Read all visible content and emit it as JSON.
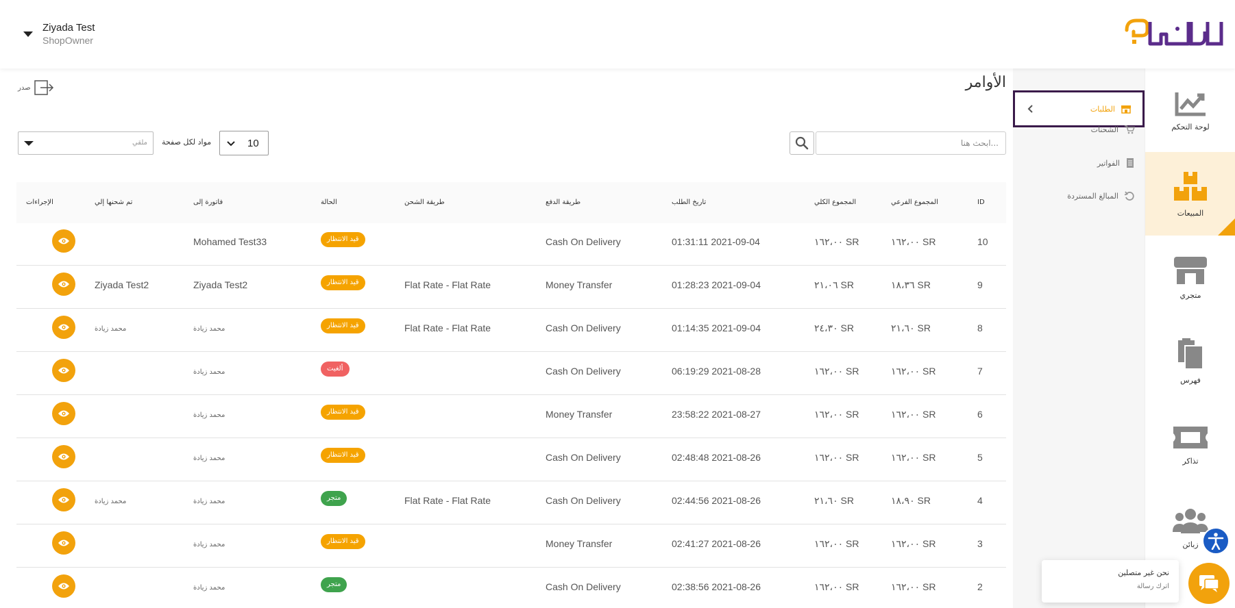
{
  "colors": {
    "accent": "#f2a20c",
    "accent_light": "#fdf0d8",
    "active_border": "#3a1a4a",
    "pending": "#f5a300",
    "canceled": "#f06262",
    "shipped": "#3fa34d",
    "purple": "#5b2c8b"
  },
  "user": {
    "name": "Ziyada Test",
    "role": "ShopOwner"
  },
  "logo": {
    "alt": "كليفا"
  },
  "rail": [
    {
      "label": "لوحة التحكم",
      "icon": "chart-icon",
      "active": false
    },
    {
      "label": "المبيعات",
      "icon": "boxes-icon",
      "active": true
    },
    {
      "label": "متجري",
      "icon": "store-icon",
      "active": false
    },
    {
      "label": "فهرس",
      "icon": "catalog-icon",
      "active": false
    },
    {
      "label": "تذاكر",
      "icon": "ticket-icon",
      "active": false
    },
    {
      "label": "زبائن",
      "icon": "customers-icon",
      "active": false
    }
  ],
  "submenu": [
    {
      "label": "الطلبات",
      "icon": "orders-icon",
      "active": true
    },
    {
      "label": "الشحنات",
      "icon": "cart-icon",
      "active": false
    },
    {
      "label": "الفواتير",
      "icon": "invoice-icon",
      "active": false
    },
    {
      "label": "المبالغ المستردة",
      "icon": "refund-icon",
      "active": false
    }
  ],
  "page": {
    "title": "الأوامر",
    "export_label": "صدر",
    "search_placeholder": "...ابحث هنا",
    "per_page_label": "مواد لكل صفحة",
    "per_page_value": "10",
    "filter_placeholder": "ملقي"
  },
  "columns": {
    "id": "ID",
    "subtotal": "المجموع الفرعي",
    "grand_total": "المجموع الكلي",
    "order_date": "تاريخ الطلب",
    "payment": "طريقة الدفع",
    "shipping": "طريقة الشحن",
    "status": "الحالة",
    "billed_to": "فاتورة إلى",
    "shipped_to": "تم شحنها إلي",
    "actions": "الإجراءات"
  },
  "orders": [
    {
      "id": "10",
      "subtotal": "١٦٢،٠٠ SR",
      "grand_total": "١٦٢،٠٠ SR",
      "date": "01:31:11 2021-09-04",
      "payment": "Cash On Delivery",
      "shipping": "",
      "status": "قيد الانتظار",
      "status_type": "pending",
      "billed_to": "Mohamed Test33",
      "billed_small": false,
      "shipped_to": "",
      "shipped_small": false
    },
    {
      "id": "9",
      "subtotal": "١٨،٣٦ SR",
      "grand_total": "٢١،٠٦ SR",
      "date": "01:28:23 2021-09-04",
      "payment": "Money Transfer",
      "shipping": "Flat Rate - Flat Rate",
      "status": "قيد الانتظار",
      "status_type": "pending",
      "billed_to": "Ziyada Test2",
      "billed_small": false,
      "shipped_to": "Ziyada Test2",
      "shipped_small": false
    },
    {
      "id": "8",
      "subtotal": "٢١،٦٠ SR",
      "grand_total": "٢٤،٣٠ SR",
      "date": "01:14:35 2021-09-04",
      "payment": "Cash On Delivery",
      "shipping": "Flat Rate - Flat Rate",
      "status": "قيد الانتظار",
      "status_type": "pending",
      "billed_to": "محمد زيادة",
      "billed_small": true,
      "shipped_to": "محمد زيادة",
      "shipped_small": true
    },
    {
      "id": "7",
      "subtotal": "١٦٢،٠٠ SR",
      "grand_total": "١٦٢،٠٠ SR",
      "date": "06:19:29 2021-08-28",
      "payment": "Cash On Delivery",
      "shipping": "",
      "status": "ألغيت",
      "status_type": "canceled",
      "billed_to": "محمد زيادة",
      "billed_small": true,
      "shipped_to": "",
      "shipped_small": false
    },
    {
      "id": "6",
      "subtotal": "١٦٢،٠٠ SR",
      "grand_total": "١٦٢،٠٠ SR",
      "date": "23:58:22 2021-08-27",
      "payment": "Money Transfer",
      "shipping": "",
      "status": "قيد الانتظار",
      "status_type": "pending",
      "billed_to": "محمد زيادة",
      "billed_small": true,
      "shipped_to": "",
      "shipped_small": false
    },
    {
      "id": "5",
      "subtotal": "١٦٢،٠٠ SR",
      "grand_total": "١٦٢،٠٠ SR",
      "date": "02:48:48 2021-08-26",
      "payment": "Cash On Delivery",
      "shipping": "",
      "status": "قيد الانتظار",
      "status_type": "pending",
      "billed_to": "محمد زيادة",
      "billed_small": true,
      "shipped_to": "",
      "shipped_small": false
    },
    {
      "id": "4",
      "subtotal": "١٨،٩٠ SR",
      "grand_total": "٢١،٦٠ SR",
      "date": "02:44:56 2021-08-26",
      "payment": "Cash On Delivery",
      "shipping": "Flat Rate - Flat Rate",
      "status": "متجر",
      "status_type": "shipped",
      "billed_to": "محمد زيادة",
      "billed_small": true,
      "shipped_to": "محمد زيادة",
      "shipped_small": true
    },
    {
      "id": "3",
      "subtotal": "١٦٢،٠٠ SR",
      "grand_total": "١٦٢،٠٠ SR",
      "date": "02:41:27 2021-08-26",
      "payment": "Money Transfer",
      "shipping": "",
      "status": "قيد الانتظار",
      "status_type": "pending",
      "billed_to": "محمد زيادة",
      "billed_small": true,
      "shipped_to": "",
      "shipped_small": false
    },
    {
      "id": "2",
      "subtotal": "١٦٢،٠٠ SR",
      "grand_total": "١٦٢،٠٠ SR",
      "date": "02:38:56 2021-08-26",
      "payment": "Cash On Delivery",
      "shipping": "",
      "status": "متجر",
      "status_type": "shipped",
      "billed_to": "محمد زيادة",
      "billed_small": true,
      "shipped_to": "",
      "shipped_small": false
    }
  ],
  "chat": {
    "title": "نحن غير متصلين",
    "subtitle": "اترك رسالة"
  }
}
